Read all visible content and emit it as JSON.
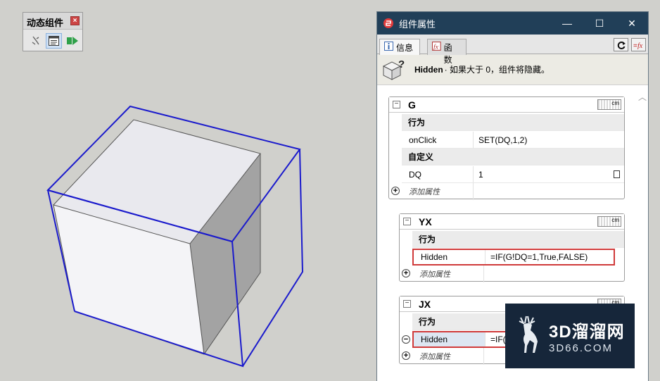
{
  "toolbar": {
    "title": "动态组件",
    "close_glyph": "×",
    "icons": [
      "interact-icon",
      "component-options-icon",
      "component-attributes-icon"
    ]
  },
  "window": {
    "title": "组件属性",
    "controls": {
      "minimize": "—",
      "maximize": "☐",
      "close": "✕"
    },
    "tabs": [
      {
        "label": "信息",
        "icon": "info-icon"
      },
      {
        "label": "函数",
        "icon": "function-icon"
      }
    ],
    "hint": {
      "key": "Hidden",
      "text": " · 如果大于 0，组件将隐藏。"
    }
  },
  "panels": [
    {
      "name": "G",
      "unit": "cm",
      "rows": [
        {
          "type": "section",
          "label": "行为"
        },
        {
          "type": "attr",
          "name": "onClick",
          "value": "SET(DQ,1,2)"
        },
        {
          "type": "section",
          "label": "自定义"
        },
        {
          "type": "attr",
          "name": "DQ",
          "value": "1"
        },
        {
          "type": "add",
          "label": "添加属性"
        }
      ]
    },
    {
      "name": "YX",
      "unit": "cm",
      "rows": [
        {
          "type": "section",
          "label": "行为"
        },
        {
          "type": "attr",
          "name": "Hidden",
          "value": "=IF(G!DQ=1,True,FALSE)"
        },
        {
          "type": "add",
          "label": "添加属性"
        }
      ]
    },
    {
      "name": "JX",
      "unit": "cm",
      "rows": [
        {
          "type": "section",
          "label": "行为"
        },
        {
          "type": "attr",
          "name": "Hidden",
          "value": "=IF("
        },
        {
          "type": "add",
          "label": "添加属性"
        }
      ]
    }
  ],
  "watermark": {
    "brand": "3D溜溜网",
    "site": "3D66.COM"
  },
  "colors": {
    "titlebar": "#213f58",
    "highlight": "#d03a3a",
    "cube_outline": "#1b1bcc",
    "viewport_bg": "#d0d0cc"
  }
}
